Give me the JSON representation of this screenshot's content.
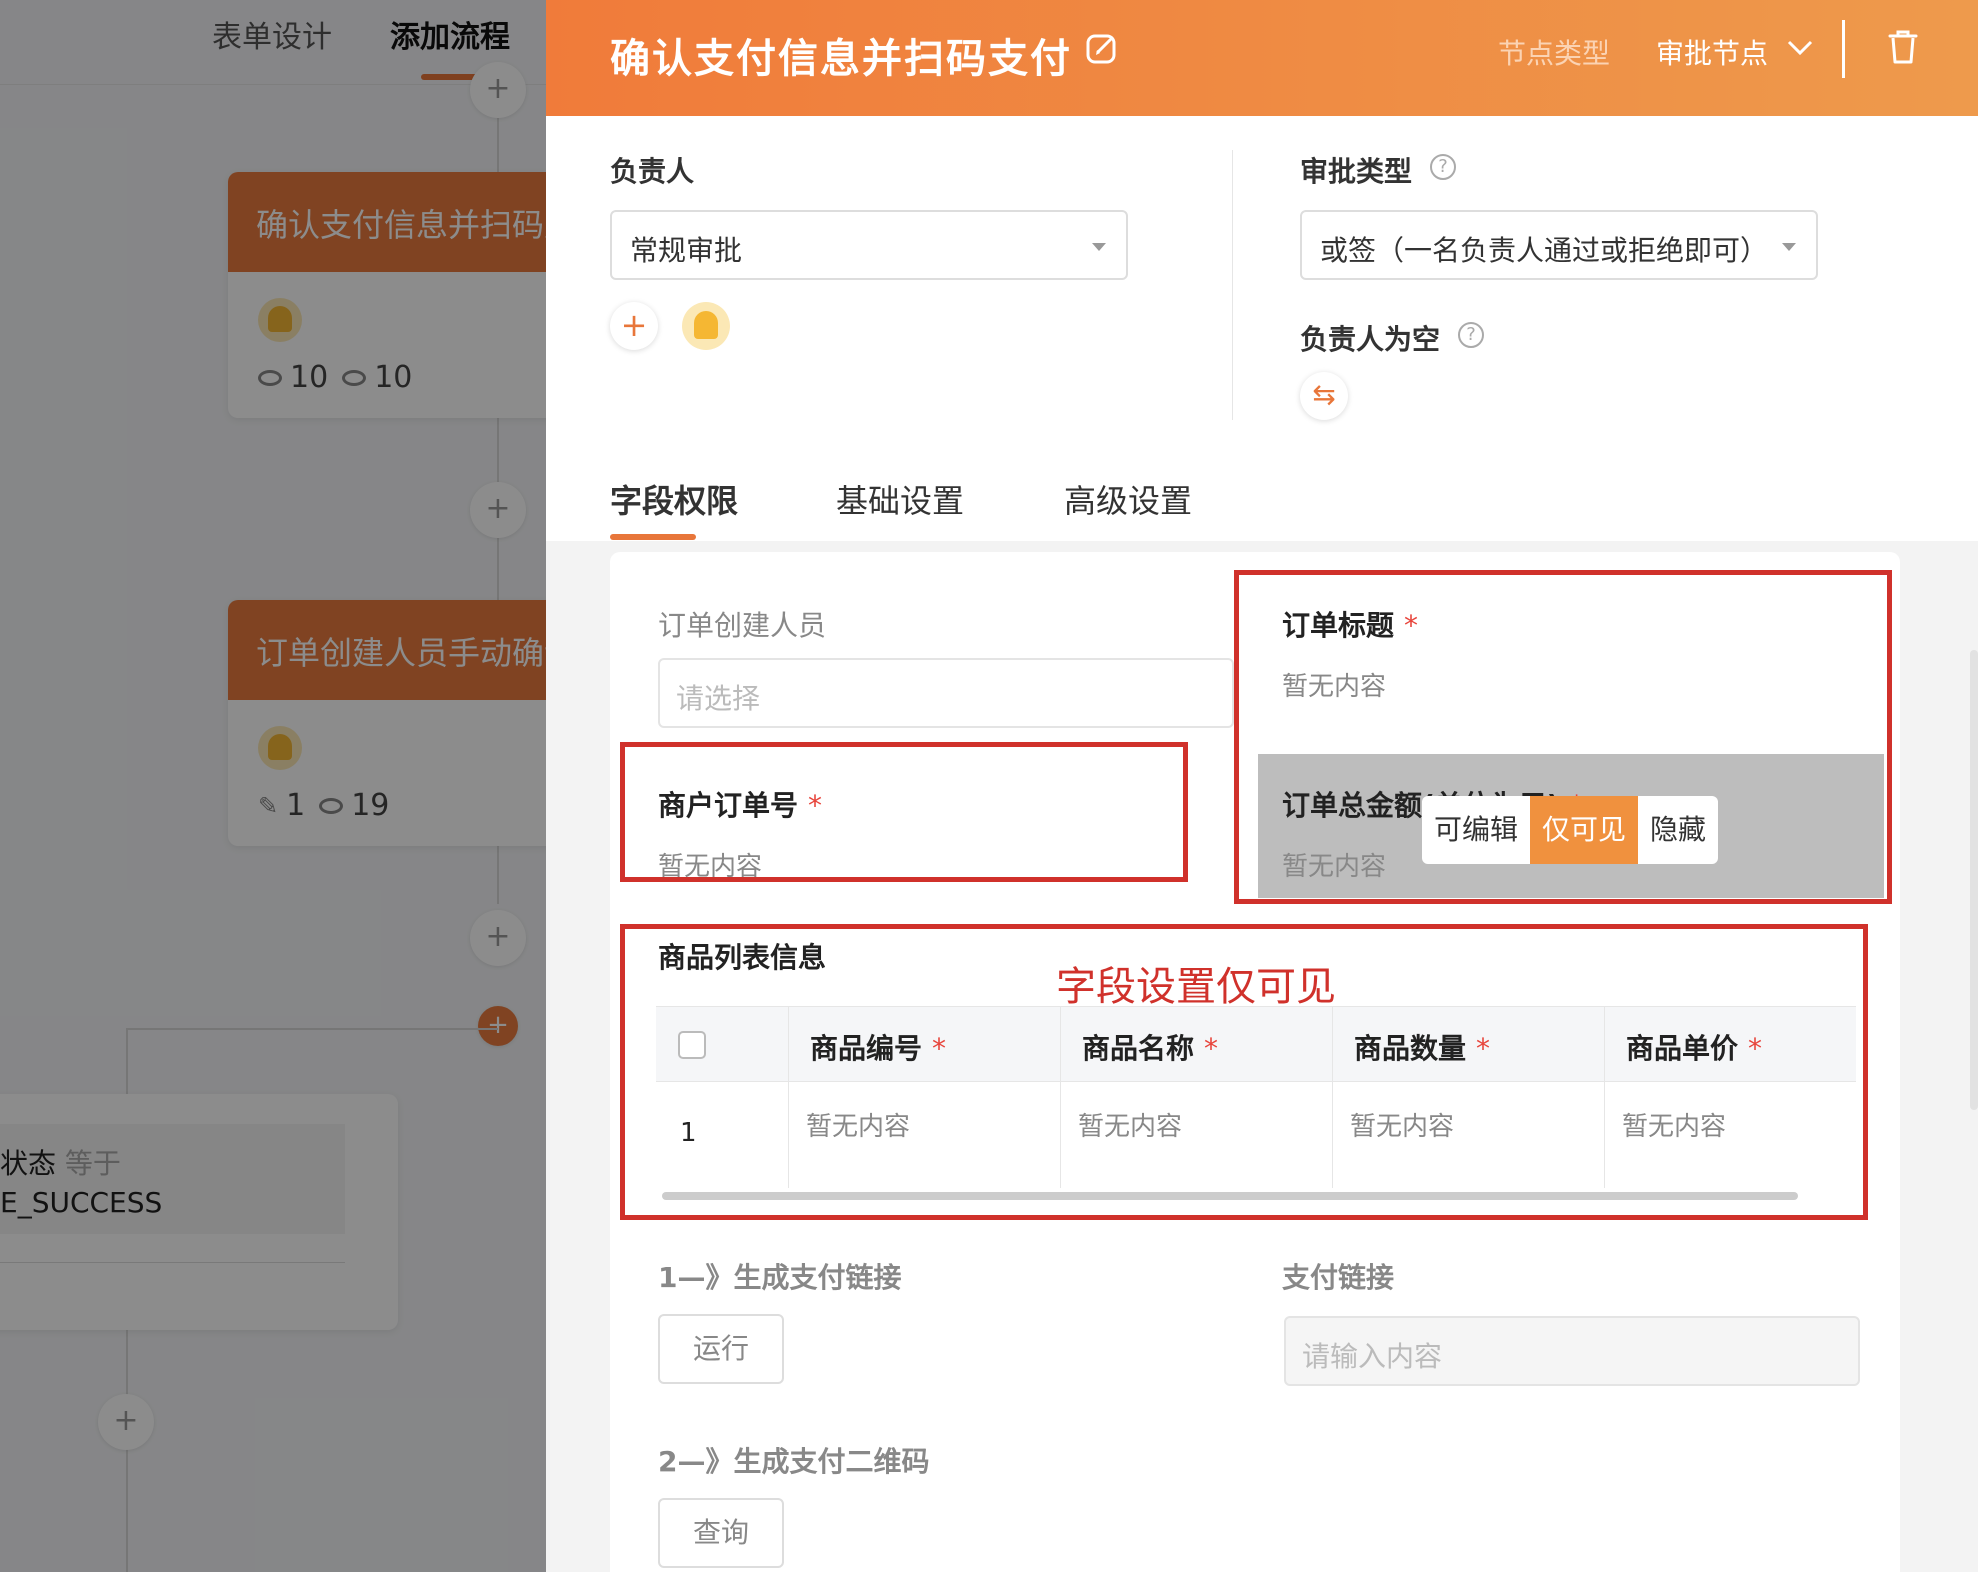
{
  "background": {
    "tabs": [
      "表单设计",
      "添加流程"
    ],
    "nodes": [
      {
        "title": "确认支付信息并扫码支付",
        "stat1_value": "10",
        "stat2_value": "10"
      },
      {
        "title": "订单创建人员手动确认",
        "stat1_value": "1",
        "stat2_value": "19"
      }
    ],
    "condition": {
      "field": "状态",
      "operator": "等于",
      "value": "E_SUCCESS"
    }
  },
  "drawer": {
    "title": "确认支付信息并扫码支付",
    "node_type_label": "节点类型",
    "node_type_value": "审批节点",
    "assignee_label": "负责人",
    "assignee_value": "常规审批",
    "approval_type_label": "审批类型",
    "approval_type_value": "或签（一名负责人通过或拒绝即可）",
    "empty_assignee_label": "负责人为空",
    "tabs": [
      "字段权限",
      "基础设置",
      "高级设置"
    ]
  },
  "form": {
    "creator_label": "订单创建人员",
    "creator_placeholder": "请选择",
    "order_title_label": "订单标题",
    "order_title_value": "暂无内容",
    "merchant_order_label": "商户订单号",
    "merchant_order_value": "暂无内容",
    "order_total_label": "订单总金额(单位为元)",
    "order_total_value": "暂无内容",
    "permission_options": [
      "可编辑",
      "仅可见",
      "隐藏"
    ],
    "product_list_label": "商品列表信息",
    "annotation": "字段设置仅可见",
    "table": {
      "columns": [
        "商品编号",
        "商品名称",
        "商品数量",
        "商品单价"
      ],
      "rows": [
        {
          "index": "1",
          "cells": [
            "暂无内容",
            "暂无内容",
            "暂无内容",
            "暂无内容"
          ]
        }
      ]
    },
    "step1_label": "1—》生成支付链接",
    "run_button": "运行",
    "pay_link_label": "支付链接",
    "pay_link_placeholder": "请输入内容",
    "step2_label": "2—》生成支付二维码",
    "query_button": "查询"
  },
  "colors": {
    "accent": "#e8763a",
    "annotation_red": "#d0312b",
    "required": "#e8453c"
  }
}
